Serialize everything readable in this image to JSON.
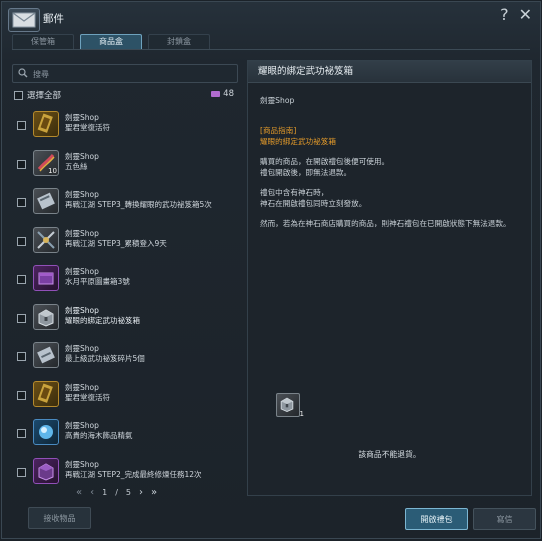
{
  "window": {
    "title": "郵件"
  },
  "title_actions": {
    "help": "?",
    "close": "✕"
  },
  "tabs": [
    {
      "label": "保管箱",
      "active": false
    },
    {
      "label": "商品盒",
      "active": true
    },
    {
      "label": "封鎖盒",
      "active": false
    }
  ],
  "search": {
    "placeholder": "搜尋",
    "value": ""
  },
  "select_all": {
    "label": "選擇全部"
  },
  "mail_count": "48",
  "items": [
    {
      "sender": "劍靈Shop",
      "subject": "聖君堂復活符",
      "qty": "",
      "thumb": "gold",
      "selected": false
    },
    {
      "sender": "劍靈Shop",
      "subject": "五色絲",
      "qty": "10",
      "thumb": "grey",
      "selected": false
    },
    {
      "sender": "劍靈Shop",
      "subject": "再戰江湖 STEP3_轉換耀眼的武功祕笈箱5次",
      "qty": "",
      "thumb": "grey",
      "selected": false
    },
    {
      "sender": "劍靈Shop",
      "subject": "再戰江湖 STEP3_累積登入9天",
      "qty": "",
      "thumb": "grey",
      "selected": false
    },
    {
      "sender": "劍靈Shop",
      "subject": "水月平原圖畫箱3號",
      "qty": "",
      "thumb": "purple",
      "selected": false
    },
    {
      "sender": "劍靈Shop",
      "subject": "耀眼的綁定武功祕笈箱",
      "qty": "",
      "thumb": "grey",
      "selected": true
    },
    {
      "sender": "劍靈Shop",
      "subject": "最上級武功祕笈碎片5個",
      "qty": "",
      "thumb": "grey",
      "selected": false
    },
    {
      "sender": "劍靈Shop",
      "subject": "聖君堂復活符",
      "qty": "",
      "thumb": "gold",
      "selected": false
    },
    {
      "sender": "劍靈Shop",
      "subject": "高貴的海木飾品精氣",
      "qty": "",
      "thumb": "blue",
      "selected": false
    },
    {
      "sender": "劍靈Shop",
      "subject": "再戰江湖 STEP2_完成最終修煉任務12次",
      "qty": "",
      "thumb": "purple",
      "selected": false
    }
  ],
  "pager": {
    "current": "1",
    "separator": "/",
    "total": "5"
  },
  "detail": {
    "title": "耀眼的綁定武功祕笈箱",
    "sender": "劍靈Shop",
    "guide_heading": "[商品指南]",
    "guide_item": "耀眼的綁定武功祕笈箱",
    "para1_line1": "購買的商品，在開啟禮包後便可使用。",
    "para1_line2": "禮包開啟後，即無法退款。",
    "para2_line1": "禮包中含有神石時，",
    "para2_line2": "神石在開啟禮包同時立刻發放。",
    "para3": "然而，若為在神石商店購買的商品，則神石禮包在已開啟狀態下無法退款。",
    "attachment_qty": "1",
    "no_return_text": "該商品不能退貨。"
  },
  "buttons": {
    "receive": "接收物品",
    "open": "開啟禮包",
    "write": "寫信"
  },
  "colors": {
    "accent": "#2b5c76",
    "highlight": "#e39a2a",
    "mail_icon": "#b06ccf"
  }
}
